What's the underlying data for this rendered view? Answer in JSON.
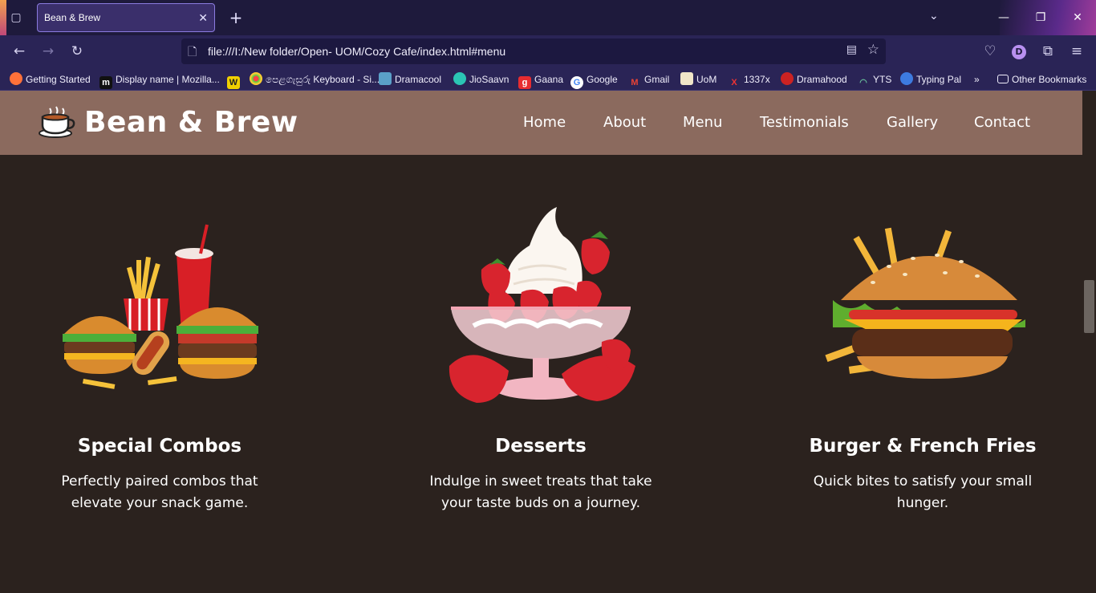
{
  "browser": {
    "tab_title": "Bean & Brew",
    "url": "file:///I:/New folder/Open- UOM/Cozy Cafe/index.html#menu",
    "profile_initial": "D",
    "bookmarks": [
      {
        "label": "Getting Started",
        "icon": "firefox-icon"
      },
      {
        "label": "Display name | Mozilla...",
        "icon": "mdn-icon"
      },
      {
        "label": "",
        "icon": "w-icon"
      },
      {
        "label": "පෙළගැසුරු Keyboard - Si...",
        "icon": "keyboard-icon"
      },
      {
        "label": "Dramacool",
        "icon": "dramacool-icon"
      },
      {
        "label": "JioSaavn",
        "icon": "jiosaavn-icon"
      },
      {
        "label": "Gaana",
        "icon": "gaana-icon"
      },
      {
        "label": "Google",
        "icon": "google-icon"
      },
      {
        "label": "Gmail",
        "icon": "gmail-icon"
      },
      {
        "label": "UoM",
        "icon": "uom-icon"
      },
      {
        "label": "1337x",
        "icon": "x-icon"
      },
      {
        "label": "Dramahood",
        "icon": "dramahood-icon"
      },
      {
        "label": "YTS",
        "icon": "yts-icon"
      },
      {
        "label": "Typing Pal",
        "icon": "typingpal-icon"
      }
    ],
    "other_bookmarks": "Other Bookmarks"
  },
  "site": {
    "brand": "Bean & Brew",
    "nav": [
      "Home",
      "About",
      "Menu",
      "Testimonials",
      "Gallery",
      "Contact"
    ]
  },
  "menu": {
    "items": [
      {
        "title": "Special Combos",
        "desc_line1": "Perfectly paired combos that",
        "desc_line2": "elevate your snack game.",
        "image": "combo-image"
      },
      {
        "title": "Desserts",
        "desc_line1": "Indulge in sweet treats that take",
        "desc_line2": "your taste buds on a journey.",
        "image": "dessert-image"
      },
      {
        "title": "Burger & French Fries",
        "desc_line1": "Quick bites to satisfy your small",
        "desc_line2": "hunger.",
        "image": "burger-image"
      }
    ]
  },
  "colors": {
    "header_bg": "#8b6a5e",
    "page_bg": "#2b221e",
    "browser_bg": "#2a2456"
  }
}
